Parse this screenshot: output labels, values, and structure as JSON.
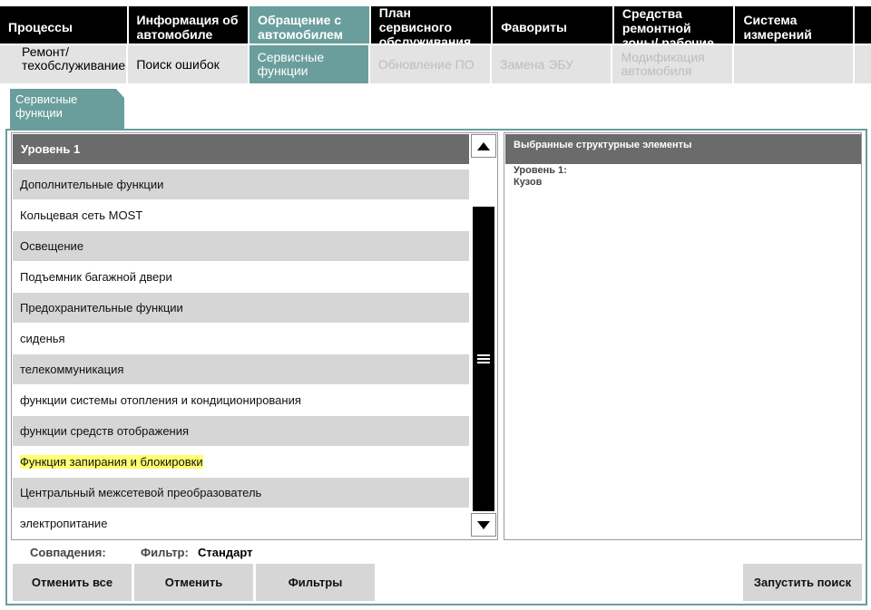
{
  "top_tabs": [
    {
      "label": "Процессы"
    },
    {
      "label": "Информация об автомобиле"
    },
    {
      "label": "Обращение с автомобилем"
    },
    {
      "label": "План сервисного обслуживания"
    },
    {
      "label": "Фавориты"
    },
    {
      "label": "Средства ремонтной зоны/ рабочие жидкости"
    },
    {
      "label": "Система измерений"
    }
  ],
  "sub_tabs": [
    {
      "label": "Ремонт/ техобслуживание"
    },
    {
      "label": "Поиск ошибок"
    },
    {
      "label": "Сервисные функции"
    },
    {
      "label": "Обновление ПО"
    },
    {
      "label": "Замена ЭБУ"
    },
    {
      "label": "Модификация автомобиля"
    }
  ],
  "panel_tab": "Сервисные функции",
  "list": {
    "header": "Уровень 1",
    "items": [
      "Дополнительные функции",
      "Кольцевая сеть MOST",
      "Освещение",
      "Подъемник багажной двери",
      "Предохранительные функции",
      "сиденья",
      "телекоммуникация",
      "функции системы отопления и кондиционирования",
      "функции средств отображения",
      "Функция запирания и блокировки",
      "Центральный межсетевой преобразователь",
      "электропитание"
    ]
  },
  "selected": {
    "header": "Выбранные структурные элементы",
    "level_label": "Уровень 1:",
    "level_value": "Кузов"
  },
  "status": {
    "matches_label": "Совпадения:",
    "filter_label": "Фильтр:",
    "filter_value": "Стандарт"
  },
  "buttons": {
    "cancel_all": "Отменить все",
    "cancel": "Отменить",
    "filters": "Фильтры",
    "start_search": "Запустить поиск"
  },
  "colors": {
    "accent": "#6a9e9c",
    "header_bar": "#6b6b6b",
    "highlight": "#ffff70"
  }
}
